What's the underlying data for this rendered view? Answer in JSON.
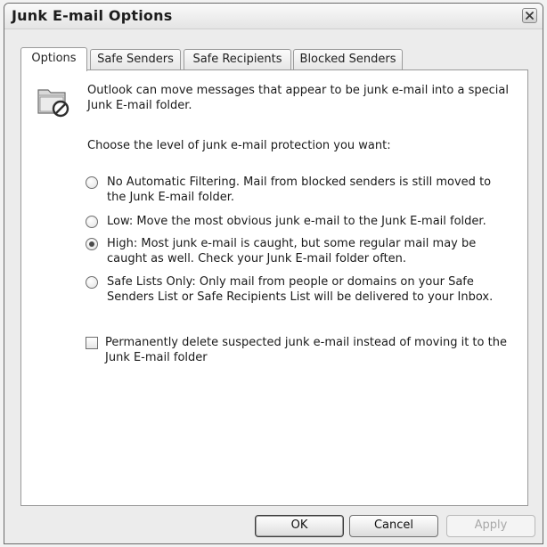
{
  "window": {
    "title": "Junk E-mail Options"
  },
  "tabs": [
    {
      "label": "Options",
      "active": true
    },
    {
      "label": "Safe Senders",
      "active": false
    },
    {
      "label": "Safe Recipients",
      "active": false
    },
    {
      "label": "Blocked Senders",
      "active": false
    }
  ],
  "options": {
    "intro_line1": "Outlook can move messages that appear to be junk e-mail into a special",
    "intro_line2": "Junk E-mail folder.",
    "level_prompt": "Choose the level of junk e-mail protection you want:",
    "radios": [
      {
        "line1": "No Automatic Filtering.  Mail from blocked senders is still moved to",
        "line2": "the Junk E-mail folder.",
        "checked": false
      },
      {
        "line1": "Low: Move the most obvious junk e-mail to the Junk E-mail folder.",
        "line2": "",
        "checked": false
      },
      {
        "line1": "High: Most junk e-mail is caught, but some regular mail may be",
        "line2": "caught as well. Check your Junk E-mail folder often.",
        "checked": true
      },
      {
        "line1": "Safe Lists Only: Only mail from people or domains on your Safe",
        "line2": "Senders List or Safe Recipients List will be delivered to your Inbox.",
        "checked": false
      }
    ],
    "permanent_delete": {
      "line1": "Permanently delete suspected junk e-mail instead of moving it to the",
      "line2": "Junk E-mail folder",
      "checked": false
    }
  },
  "buttons": {
    "ok": "OK",
    "cancel": "Cancel",
    "apply": "Apply"
  },
  "icons": {
    "folder": "junk-folder-icon",
    "close": "close-icon"
  }
}
